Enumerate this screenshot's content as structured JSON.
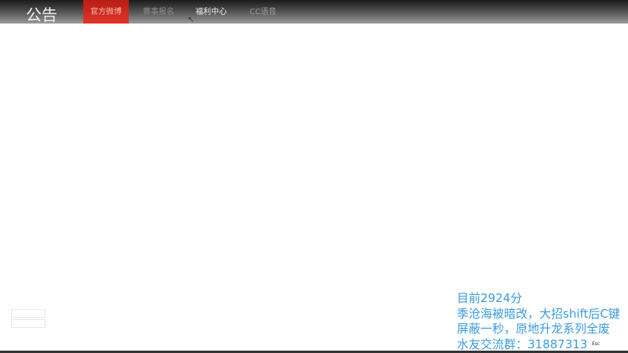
{
  "header": {
    "title": "公告",
    "tabs": [
      {
        "label": "官方微博",
        "active": true
      },
      {
        "label": "赛事报名"
      },
      {
        "label": "福利中心"
      },
      {
        "label": "CC语音"
      }
    ]
  },
  "overlay": {
    "lines": [
      "目前2924分",
      "季沧海被暗改，大招shift后C键",
      "屏蔽一秒，原地升龙系列全废",
      "水友交流群：31887313"
    ],
    "esc_label": "Esc",
    "color": "#3a9be0"
  }
}
